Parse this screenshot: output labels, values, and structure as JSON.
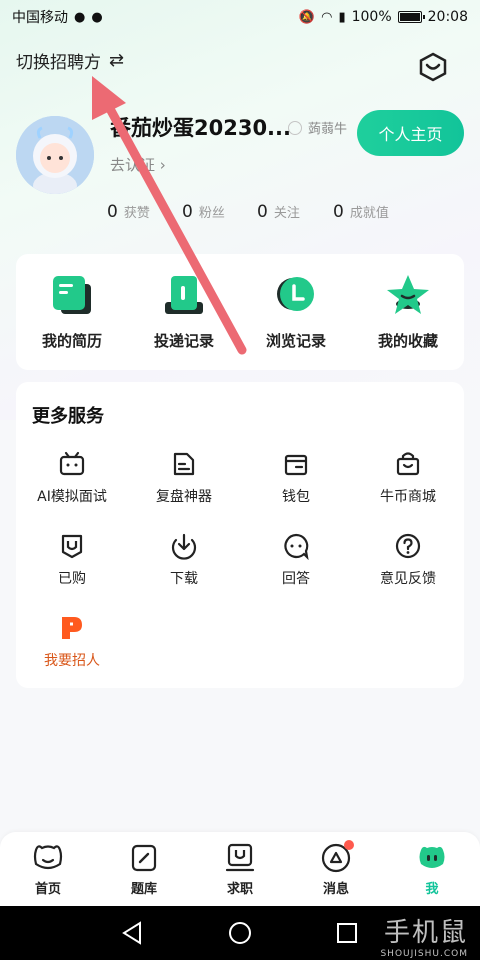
{
  "status_bar": {
    "carrier": "中国移动",
    "battery": "100%",
    "time": "20:08"
  },
  "header": {
    "switch_role_label": "切换招聘方",
    "switch_icon": "swap-arrows-icon",
    "settings_icon": "hexagon-icon"
  },
  "profile": {
    "username": "番茄炒蛋20230...",
    "level_badge": "蒟蒻牛",
    "verify_label": "去认证",
    "home_button": "个人主页",
    "stats": [
      {
        "num": "0",
        "label": "获赞"
      },
      {
        "num": "0",
        "label": "粉丝"
      },
      {
        "num": "0",
        "label": "关注"
      },
      {
        "num": "0",
        "label": "成就值"
      }
    ]
  },
  "records": [
    {
      "label": "我的简历",
      "icon": "resume-icon"
    },
    {
      "label": "投递记录",
      "icon": "delivery-record-icon"
    },
    {
      "label": "浏览记录",
      "icon": "browse-history-icon"
    },
    {
      "label": "我的收藏",
      "icon": "favorite-star-icon"
    }
  ],
  "services": {
    "title": "更多服务",
    "items": [
      {
        "label": "AI模拟面试",
        "icon": "tv-robot-icon"
      },
      {
        "label": "复盘神器",
        "icon": "note-icon"
      },
      {
        "label": "钱包",
        "icon": "wallet-icon"
      },
      {
        "label": "牛币商城",
        "icon": "shopping-bag-icon"
      },
      {
        "label": "已购",
        "icon": "purchased-icon"
      },
      {
        "label": "下载",
        "icon": "download-icon"
      },
      {
        "label": "回答",
        "icon": "answer-icon"
      },
      {
        "label": "意见反馈",
        "icon": "feedback-question-icon"
      },
      {
        "label": "我要招人",
        "icon": "hire-icon"
      }
    ]
  },
  "tabs": [
    {
      "label": "首页",
      "icon": "home-mascot-icon",
      "active": false
    },
    {
      "label": "题库",
      "icon": "question-bank-icon",
      "active": false
    },
    {
      "label": "求职",
      "icon": "job-search-icon",
      "active": false
    },
    {
      "label": "消息",
      "icon": "message-icon",
      "active": false,
      "has_badge": true
    },
    {
      "label": "我",
      "icon": "me-mascot-icon",
      "active": true
    }
  ],
  "watermark": {
    "main": "手机鼠",
    "sub": "SHOUJISHU.COM"
  },
  "colors": {
    "accent": "#12c49a",
    "hire": "#d9571a",
    "badge": "#ff5a4e"
  }
}
